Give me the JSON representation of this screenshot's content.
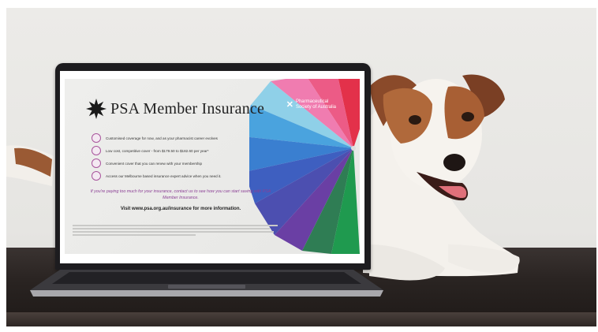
{
  "ad": {
    "title": "PSA Member Insurance",
    "brand_line1": "Pharmaceutical",
    "brand_line2": "Society of Australia",
    "bullets": [
      "Customised coverage for now, and as your pharmacist career evolves",
      "Low cost, competitive cover - from $179.50 to $182.60 per year*",
      "Convenient cover that you can renew with your membership",
      "Access our Melbourne based insurance expert advice when you need it."
    ],
    "promo": "If you're paying too much for your insurance, contact us to see how you can start saving with PSA Member Insurance.",
    "visit": "Visit www.psa.org.au/insurance for more information."
  },
  "colors": {
    "accent_purple": "#8b3f95",
    "laptop_bezel": "#1d1c1f",
    "table": "#2a2422"
  },
  "icons": [
    "psa-star-logo-icon",
    "umbrella-image",
    "bullet-icon"
  ]
}
